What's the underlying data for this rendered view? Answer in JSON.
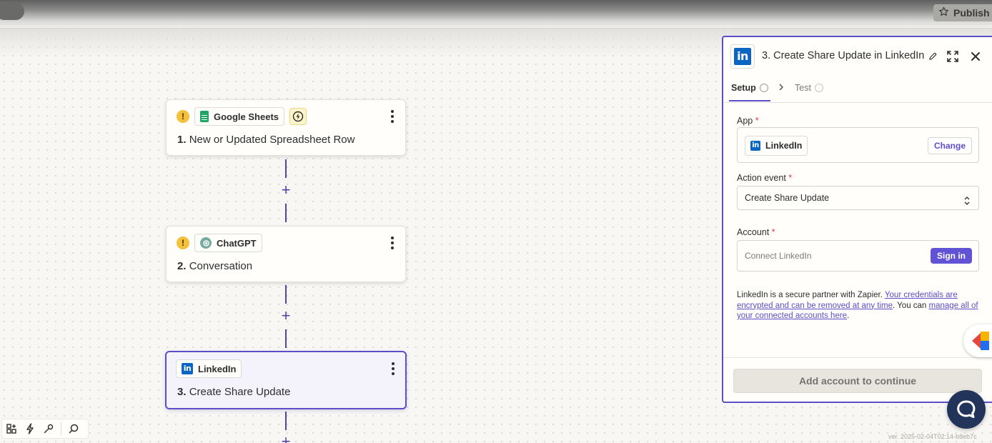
{
  "topbar": {
    "publish_label": "Publish"
  },
  "steps": [
    {
      "number": "1.",
      "title": "New or Updated Spreadsheet Row",
      "app": "Google Sheets",
      "warning": "!"
    },
    {
      "number": "2.",
      "title": "Conversation",
      "app": "ChatGPT",
      "warning": "!"
    },
    {
      "number": "3.",
      "title": "Create Share Update",
      "app": "LinkedIn"
    }
  ],
  "canvas": {
    "add_step_label": "+"
  },
  "panel": {
    "title": "3. Create Share Update in LinkedIn",
    "logo_text": "in",
    "tabs": {
      "setup": "Setup",
      "test": "Test"
    },
    "app_label": "App",
    "required_mark": "*",
    "app_value": "LinkedIn",
    "change_label": "Change",
    "action_event_label": "Action event",
    "action_event_value": "Create Share Update",
    "account_label": "Account",
    "account_placeholder": "Connect LinkedIn",
    "signin_label": "Sign in",
    "info": {
      "prefix": "LinkedIn is a secure partner with Zapier. ",
      "link1": "Your credentials are encrypted and can be removed at any time",
      "middle": ". You can ",
      "link2": "manage all of your connected accounts here",
      "suffix": "."
    },
    "continue_label": "Add account to continue"
  },
  "colors": {
    "accent": "#5c4ec9",
    "linkedin": "#0a66c2",
    "warning": "#f5c13a",
    "chat": "#23345a"
  },
  "version": "ver. 2025-02-04T02:14-b8eb7c"
}
